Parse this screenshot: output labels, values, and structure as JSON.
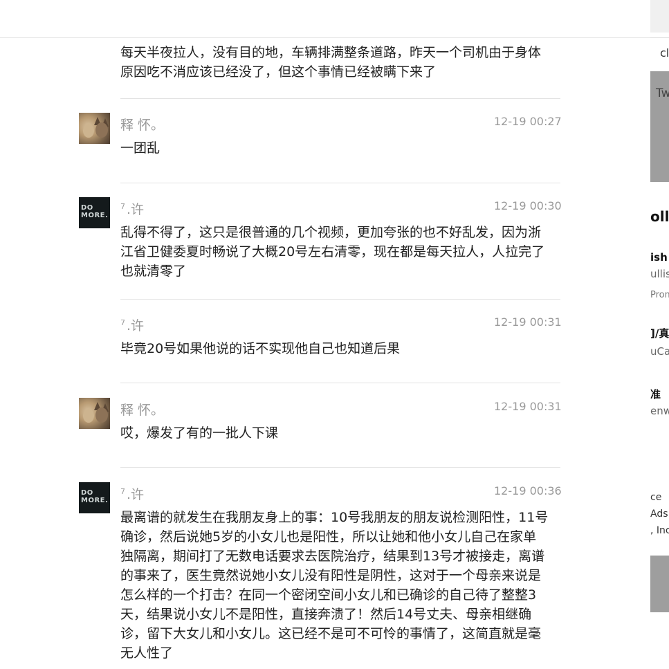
{
  "first_text": "每天半夜拉人，没有目的地，车辆排满整条道路，昨天一个司机由于身体原因吃不消应该已经没了，但这个事情已经被瞒下来了",
  "comments": [
    {
      "author": "释 怀。",
      "time": "12-19 00:27",
      "text": "一团乱",
      "avatar": "lion-cat-avatar"
    },
    {
      "author_sup": "7",
      "author": ".许",
      "time": "12-19 00:30",
      "text": "乱得不得了，这只是很普通的几个视频，更加夸张的也不好乱发，因为浙江省卫健委夏时畅说了大概20号左右清零，现在都是每天拉人，人拉完了也就清零了",
      "avatar": "do-more-avatar",
      "avatar_text": [
        "DO",
        "MORE."
      ]
    },
    {
      "author_sup": "7",
      "author": ".许",
      "time": "12-19 00:31",
      "text": "毕竟20号如果他说的话不实现他自己也知道后果"
    },
    {
      "author": "释 怀。",
      "time": "12-19 00:31",
      "text": "哎，爆发了有的一批人下课",
      "avatar": "lion-cat-avatar"
    },
    {
      "author_sup": "7",
      "author": ".许",
      "time": "12-19 00:36",
      "text": "最离谱的就发生在我朋友身上的事：10号我朋友的朋友说检测阳性，11号确诊，然后说她5岁的小女儿也是阳性，所以让她和他小女儿自己在家单独隔离，期间打了无数电话要求去医院治疗，结果到13号才被接走，离谱的事来了，医生竟然说她小女儿没有阳性是阴性，这对于一个母亲来说是怎么样的一个打击？在同一个密闭空间小女儿和已确诊的自己待了整整3天，结果说小女儿不是阳性，直接奔溃了！然后14号丈夫、母亲相继确诊，留下大女儿和小女儿。这已经不是可不可怜的事情了，这简直就是毫无人性了",
      "avatar": "do-more-avatar",
      "avatar_text": [
        "DO",
        "MORE."
      ]
    }
  ],
  "right_panel": {
    "search_fragment": "cl",
    "tab_fragment": "Tw",
    "heading_fragment": "olle",
    "item1_title": "ish",
    "item1_sub": "ullis",
    "item1_meta": "Prom",
    "item2_title": "]/真",
    "item2_sub": "uCa",
    "item3_title": "准",
    "item3_sub": "enw",
    "footer1": "ce",
    "footer2": "Ads",
    "footer3": ", Inc"
  }
}
